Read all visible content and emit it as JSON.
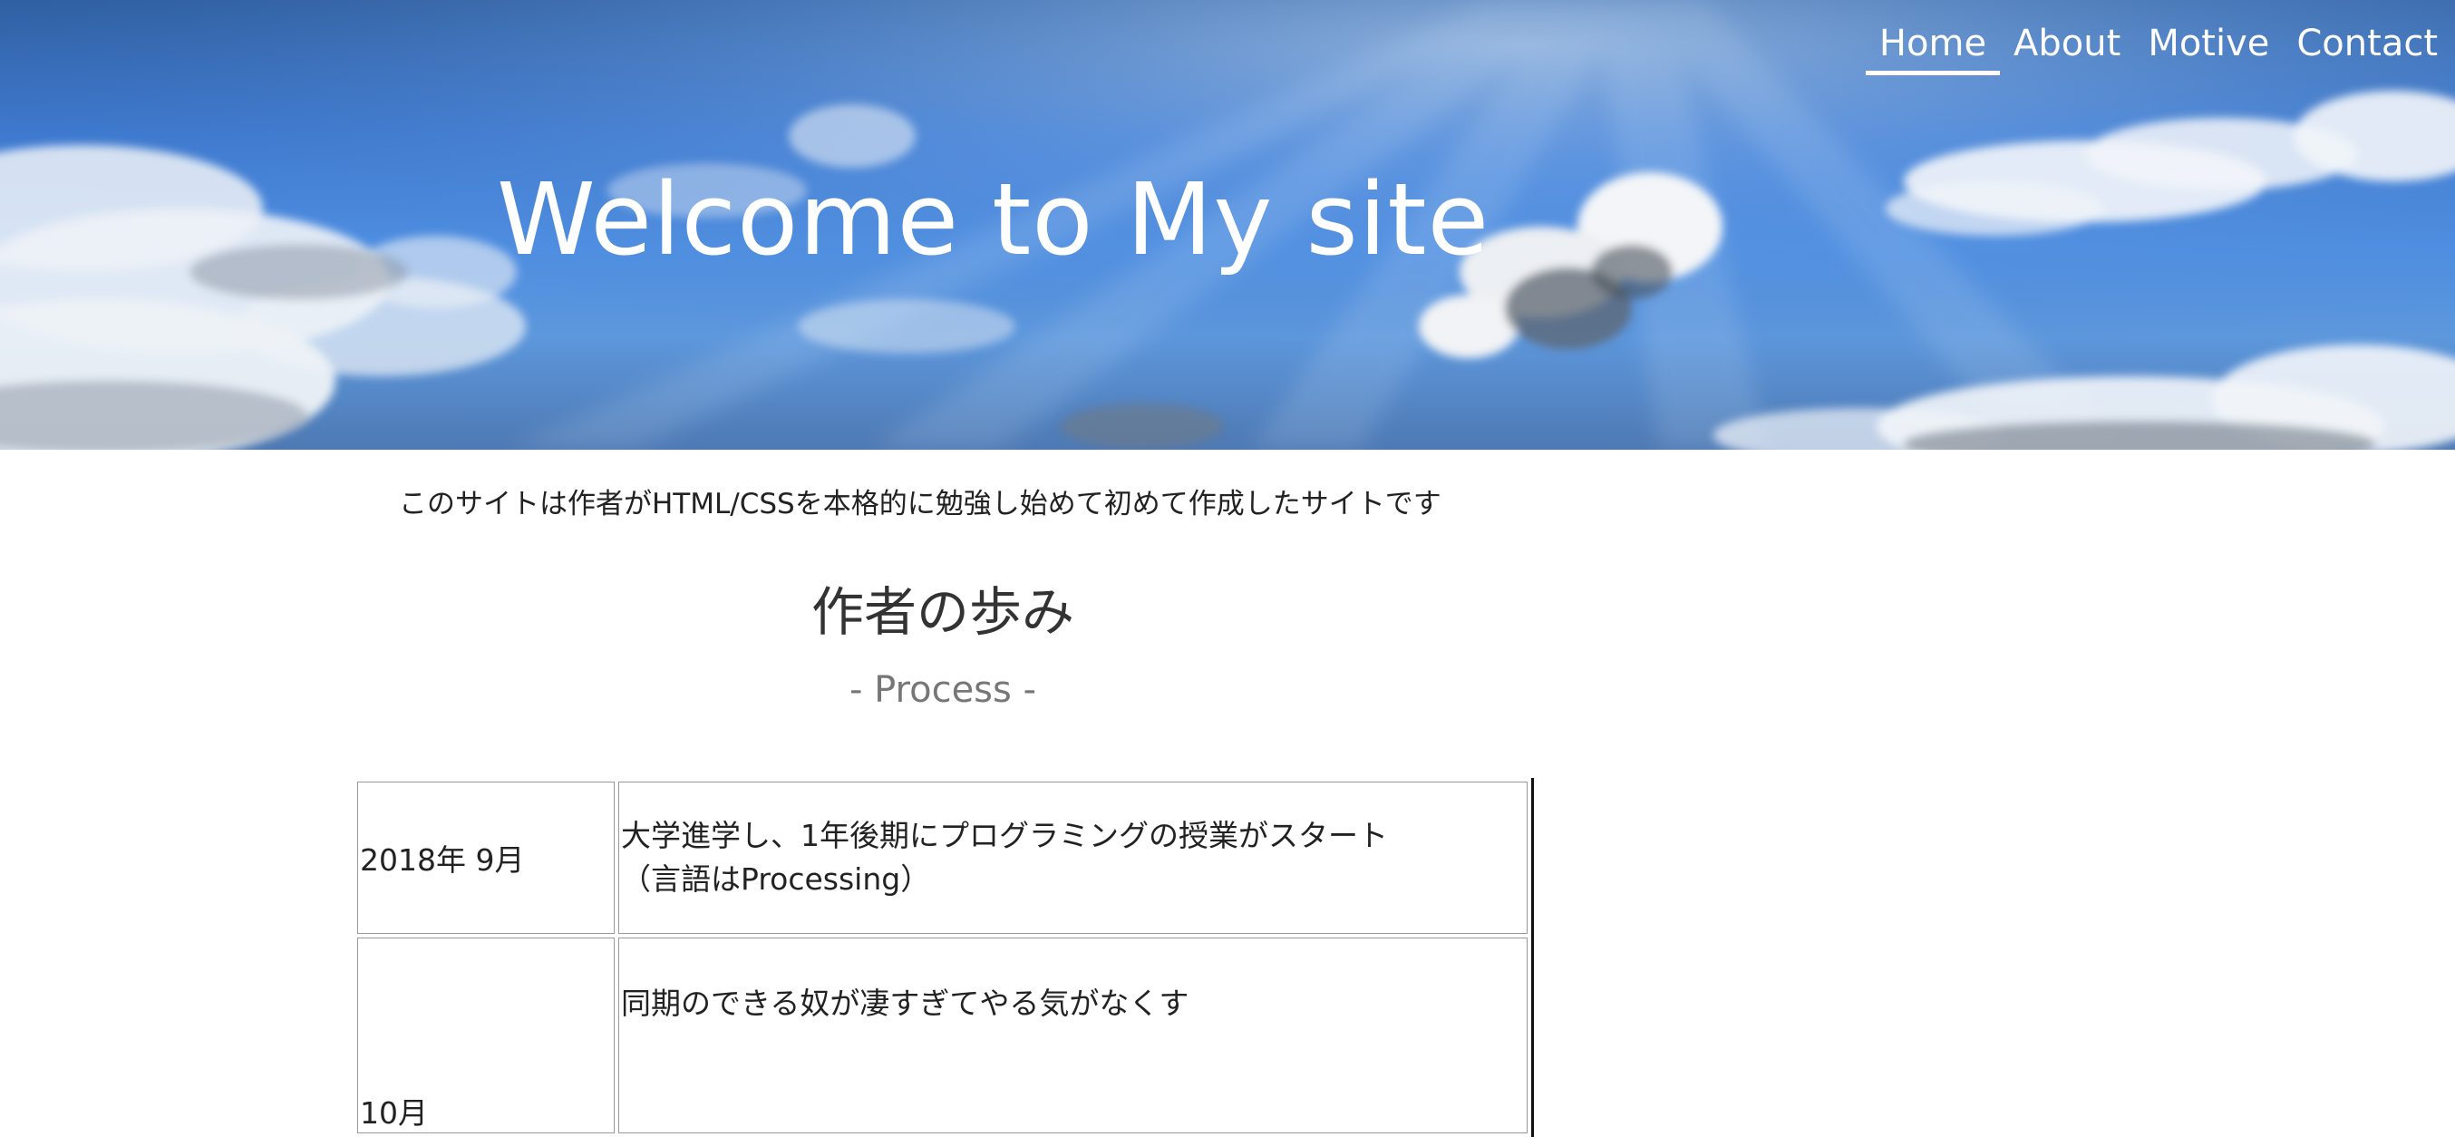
{
  "nav": {
    "items": [
      {
        "label": "Home",
        "active": true
      },
      {
        "label": "About",
        "active": false
      },
      {
        "label": "Motive",
        "active": false
      },
      {
        "label": "Contact",
        "active": false
      }
    ]
  },
  "hero": {
    "title": "Welcome to My site"
  },
  "main": {
    "intro": "このサイトは作者がHTML/CSSを本格的に勉強し始めて初めて作成したサイトです",
    "section_title": "作者の歩み",
    "section_subtitle": "- Process -",
    "timeline": [
      {
        "date": "2018年 9月",
        "lines": [
          "大学進学し、1年後期にプログラミングの授業がスタート",
          "（言語はProcessing）"
        ]
      },
      {
        "date": "10月",
        "lines": [
          "同期のできる奴が凄すぎてやる気がなくす"
        ]
      }
    ]
  },
  "colors": {
    "sky": "#4f8fe3",
    "nav_text": "#ffffff",
    "subtitle": "#777777"
  }
}
